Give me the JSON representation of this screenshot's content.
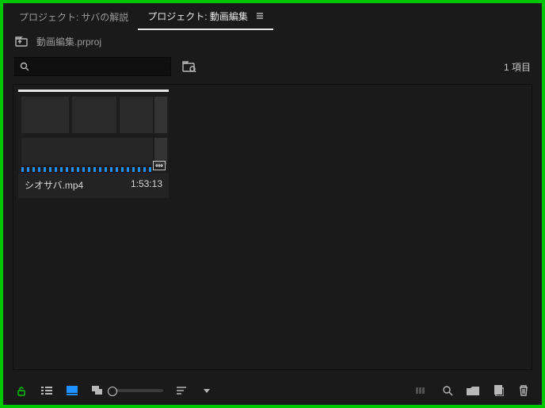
{
  "tabs": {
    "inactive": "プロジェクト: サバの解説",
    "active": "プロジェクト: 動画編集"
  },
  "project": {
    "filename": "動画編集.prproj"
  },
  "search": {
    "placeholder": ""
  },
  "item_count": "1 項目",
  "clip": {
    "name": "シオサバ.mp4",
    "duration": "1:53:13"
  }
}
